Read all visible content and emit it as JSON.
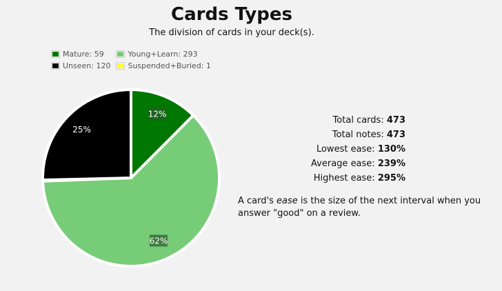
{
  "title": "Cards Types",
  "subtitle": "The division of cards in your deck(s).",
  "chart_data": {
    "type": "pie",
    "title": "Cards Types",
    "categories": [
      "Mature",
      "Young+Learn",
      "Suspended+Buried",
      "Unseen"
    ],
    "values": [
      59,
      293,
      1,
      120
    ],
    "colors": [
      "#007700",
      "#77cc77",
      "#ffff33",
      "#000000"
    ],
    "slice_labels": [
      "12%",
      "62%",
      "",
      "25%"
    ],
    "legend": [
      "Mature: 59",
      "Young+Learn: 293",
      "Unseen: 120",
      "Suspended+Buried: 1"
    ],
    "legend_colors": [
      "#007700",
      "#77cc77",
      "#000000",
      "#ffff33"
    ],
    "legend_position": "top-left"
  },
  "stats": [
    {
      "label": "Total cards:",
      "value": "473"
    },
    {
      "label": "Total notes:",
      "value": "473"
    },
    {
      "label": "Lowest ease:",
      "value": "130%"
    },
    {
      "label": "Average ease:",
      "value": "239%"
    },
    {
      "label": "Highest ease:",
      "value": "295%"
    }
  ],
  "note": {
    "pre": "A card's ",
    "em": "ease",
    "post": " is the size of the next interval when you answer \"good\" on a review."
  }
}
